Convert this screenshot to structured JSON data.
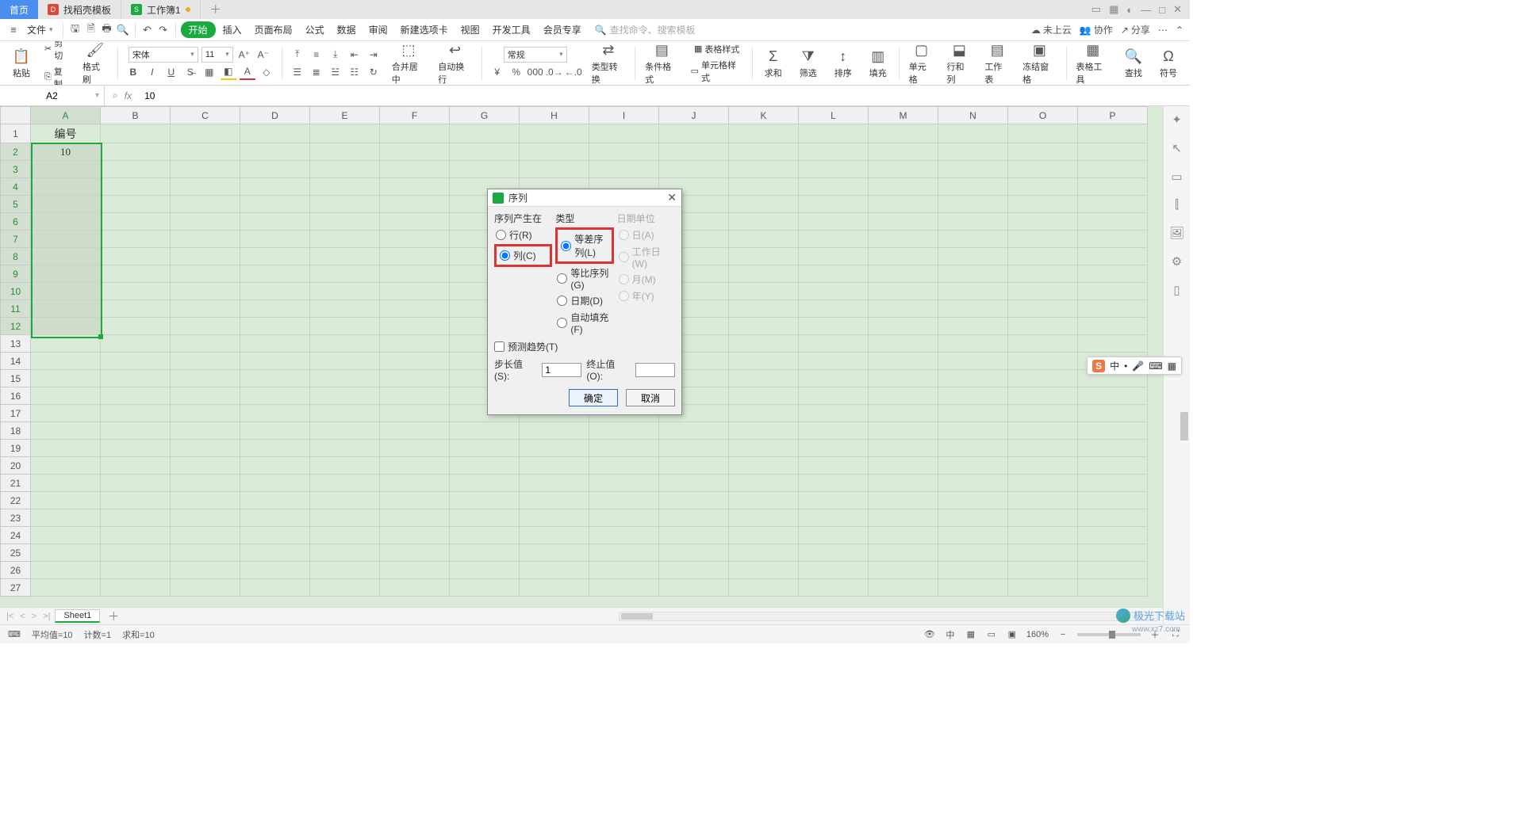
{
  "tabs": {
    "home": "首页",
    "templates": "找稻壳模板",
    "workbook": "工作簿1"
  },
  "menubar": {
    "file": "文件",
    "items": [
      "开始",
      "插入",
      "页面布局",
      "公式",
      "数据",
      "审阅",
      "新建选项卡",
      "视图",
      "开发工具",
      "会员专享"
    ],
    "search_placeholder": "查找命令、搜索模板",
    "unsync": "未上云",
    "coop": "协作",
    "share": "分享"
  },
  "ribbon": {
    "paste": "粘贴",
    "cut": "剪切",
    "copy": "复制",
    "format_painter": "格式刷",
    "font": "宋体",
    "size": "11",
    "merge_center": "合并居中",
    "wrap": "自动换行",
    "number_format": "常规",
    "type_convert": "类型转换",
    "cond_format": "条件格式",
    "table_style": "表格样式",
    "cell_style": "单元格样式",
    "sum": "求和",
    "filter": "筛选",
    "sort": "排序",
    "fill": "填充",
    "cell": "单元格",
    "rowcol": "行和列",
    "worksheet": "工作表",
    "freeze": "冻结窗格",
    "tools": "表格工具",
    "find": "查找",
    "symbol": "符号"
  },
  "namebox": "A2",
  "fx_value": "10",
  "columns": [
    "A",
    "B",
    "C",
    "D",
    "E",
    "F",
    "G",
    "H",
    "I",
    "J",
    "K",
    "L",
    "M",
    "N",
    "O",
    "P"
  ],
  "rows_count": 27,
  "cells": {
    "A1": "编号",
    "A2": "10"
  },
  "dialog": {
    "title": "序列",
    "series_in": "序列产生在",
    "row": "行(R)",
    "col": "列(C)",
    "type": "类型",
    "linear": "等差序列(L)",
    "growth": "等比序列(G)",
    "date": "日期(D)",
    "autofill": "自动填充(F)",
    "date_unit": "日期单位",
    "day": "日(A)",
    "weekday": "工作日(W)",
    "month": "月(M)",
    "year": "年(Y)",
    "trend": "预测趋势(T)",
    "step_label": "步长值(S):",
    "step_value": "1",
    "stop_label": "终止值(O):",
    "stop_value": "",
    "ok": "确定",
    "cancel": "取消"
  },
  "sheet_tab": "Sheet1",
  "status": {
    "avg": "平均值=10",
    "count": "计数=1",
    "sum": "求和=10",
    "zoom": "160%"
  },
  "ime": {
    "lang": "中",
    "punc": "•",
    "mic": "🎤",
    "kb": "⌨",
    "grid": "▦"
  },
  "watermark": {
    "t": "极光下载站",
    "s": "www.xz7.com"
  }
}
